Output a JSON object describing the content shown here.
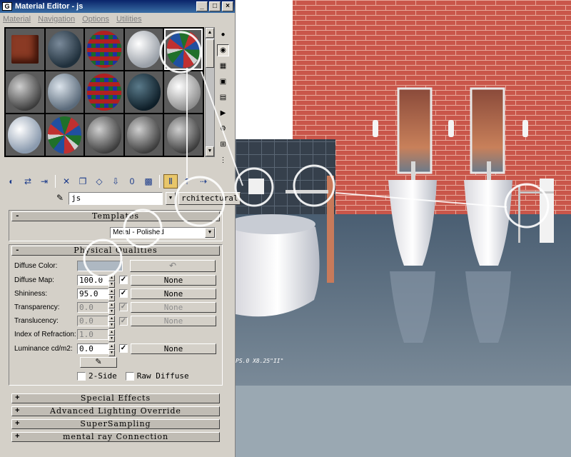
{
  "window": {
    "title": "Material Editor - js",
    "icon": "3dsmax-icon"
  },
  "menu": [
    "Material",
    "Navigation",
    "Options",
    "Utilities"
  ],
  "slots": [
    {
      "kind": "brick"
    },
    {
      "kind": "dark-blue"
    },
    {
      "kind": "checker"
    },
    {
      "kind": "white"
    },
    {
      "kind": "swirl",
      "active": true
    },
    {
      "kind": "grey"
    },
    {
      "kind": "blue-grey"
    },
    {
      "kind": "checker"
    },
    {
      "kind": "dark-teal"
    },
    {
      "kind": "light"
    },
    {
      "kind": "light-blue"
    },
    {
      "kind": "swirl"
    },
    {
      "kind": "grey"
    },
    {
      "kind": "grey"
    },
    {
      "kind": "grey"
    }
  ],
  "right_tools": [
    "sample-type-icon",
    "backlight-icon",
    "background-icon",
    "uv-tiling-icon",
    "video-check-icon",
    "make-preview-icon",
    "options-icon",
    "select-by-material-icon",
    "material-navigator-icon"
  ],
  "toolbar": [
    "get-material-icon",
    "put-to-scene-icon",
    "assign-to-selection-icon",
    "reset-icon",
    "make-copy-icon",
    "make-unique-icon",
    "put-to-library-icon",
    "material-effects-icon",
    "show-map-icon",
    "show-end-result-icon",
    "go-to-parent-icon",
    "go-forward-icon"
  ],
  "material": {
    "name": "js",
    "type_button": "rchitectural"
  },
  "templates": {
    "header": "Templates",
    "selected": "Metal - Polished"
  },
  "physical": {
    "header": "Physical Qualities",
    "diffuse_color_label": "Diffuse Color:",
    "diffuse_color": "#aeb8c2",
    "rows": [
      {
        "label": "Diffuse Map:",
        "value": "100.0",
        "checked": true,
        "map": "None",
        "enabled": true
      },
      {
        "label": "Shininess:",
        "value": "95.0",
        "checked": true,
        "map": "None",
        "enabled": true
      },
      {
        "label": "Transparency:",
        "value": "0.0",
        "checked": true,
        "map": "None",
        "enabled": false
      },
      {
        "label": "Translucency:",
        "value": "0.0",
        "checked": true,
        "map": "None",
        "enabled": false
      },
      {
        "label": "Index of Refraction:",
        "value": "1.0",
        "enabled": false
      },
      {
        "label": "Luminance cd/m2:",
        "value": "0.0",
        "checked": true,
        "map": "None",
        "enabled": true
      }
    ],
    "two_side": "2-Side",
    "raw_diffuse": "Raw Diffuse"
  },
  "collapsed_rollouts": [
    "Special Effects",
    "Advanced Lighting Override",
    "SuperSampling",
    "mental ray Connection"
  ],
  "scene": {
    "floor_caption": "PS.0 X8.25\"II\""
  }
}
